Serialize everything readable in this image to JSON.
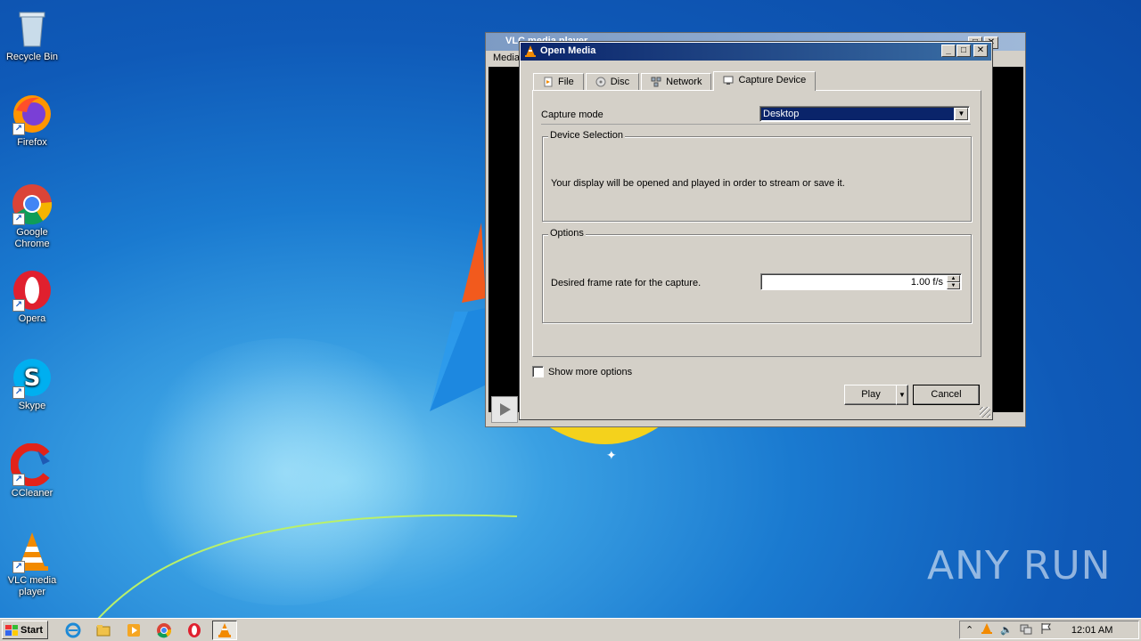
{
  "desktop": {
    "icons": [
      {
        "label": "Recycle Bin"
      },
      {
        "label": "Firefox"
      },
      {
        "label": "Google Chrome"
      },
      {
        "label": "Opera"
      },
      {
        "label": "Skype"
      },
      {
        "label": "CCleaner"
      },
      {
        "label": "VLC media player"
      }
    ]
  },
  "vlc_main": {
    "title": "VLC media player",
    "menu_first": "Media",
    "time_left": "--:--",
    "time_right": "--:--"
  },
  "dialog": {
    "title": "Open Media",
    "tabs": [
      {
        "label": "File",
        "icon": "file-icon"
      },
      {
        "label": "Disc",
        "icon": "disc-icon"
      },
      {
        "label": "Network",
        "icon": "network-icon"
      },
      {
        "label": "Capture Device",
        "icon": "capture-device-icon",
        "active": true
      }
    ],
    "capture_mode_label": "Capture mode",
    "capture_mode_value": "Desktop",
    "device_selection_legend": "Device Selection",
    "device_message": "Your display will be opened and played in order to stream or save it.",
    "options_legend": "Options",
    "frame_rate_label": "Desired frame rate for the capture.",
    "frame_rate_value": "1.00 f/s",
    "show_more_label": "Show more options",
    "show_more_checked": false,
    "play_label": "Play",
    "cancel_label": "Cancel"
  },
  "taskbar": {
    "start_label": "Start",
    "clock": "12:01 AM"
  },
  "watermark": "ANY RUN",
  "colors": {
    "title_active": "#0a246a",
    "window_face": "#d4d0c8",
    "selection": "#0a246a"
  }
}
